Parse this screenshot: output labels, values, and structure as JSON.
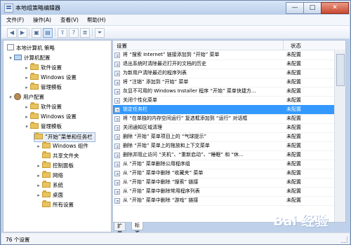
{
  "window": {
    "title": "本地组策略编辑器",
    "controls": {
      "minimize": "—",
      "maximize": "□",
      "close": "✕"
    }
  },
  "menu": [
    "文件(F)",
    "操作(A)",
    "查看(V)",
    "帮助(H)"
  ],
  "toolbar": {
    "icons": [
      "back-arrow-icon",
      "forward-arrow-icon",
      "folder-up-icon",
      "show-hide-tree-icon",
      "export-list-icon",
      "help-icon",
      "properties-icon",
      "filter-icon"
    ]
  },
  "tree": {
    "root": "本地计算机 策略",
    "computer_config": "计算机配置",
    "cc_items": [
      "软件设置",
      "Windows 设置",
      "管理模板"
    ],
    "user_config": "用户配置",
    "uc_items": [
      "软件设置",
      "Windows 设置"
    ],
    "admin_templates": "管理模板",
    "at_items": [
      "“开始”菜单和任务栏",
      "Windows 组件",
      "共享文件夹",
      "控制面板",
      "网络",
      "系统",
      "桌面",
      "所有设置"
    ]
  },
  "list": {
    "col_setting": "设置",
    "col_state": "状态",
    "rows": [
      {
        "name": "将 “搜索 Internet” 链接添加到 “开始” 菜单",
        "state": "未配置"
      },
      {
        "name": "退出系统时清除最近打开的文档的历史",
        "state": "未配置"
      },
      {
        "name": "为新用户清除最近的程序列表",
        "state": "未配置"
      },
      {
        "name": "将 “注销” 添加到 “开始” 菜单",
        "state": "未配置"
      },
      {
        "name": "灰显不可用的 Windows Installer 程序 “开始” 菜单快捷方...",
        "state": "未配置"
      },
      {
        "name": "关闭个性化菜单",
        "state": "未配置"
      },
      {
        "name": "锁定任务栏",
        "state": "未配置"
      },
      {
        "name": "将 “在单独的内存空间运行” 复选框添加到 “运行” 对话框",
        "state": "未配置"
      },
      {
        "name": "关闭通知区域清理",
        "state": "未配置"
      },
      {
        "name": "删除 “开始” 菜单项目上的 “气球提示”",
        "state": "未配置"
      },
      {
        "name": "删除 “开始” 菜单上的拖放和上下文菜单",
        "state": "未配置"
      },
      {
        "name": "删除并阻止访问 “关机”、“重新启动”、“睡眠” 和 “休...",
        "state": "未配置"
      },
      {
        "name": "从 “开始” 菜单删除公用程序组",
        "state": "未配置"
      },
      {
        "name": "从 “开始” 菜单中删除 “收藏夹” 菜单",
        "state": "未配置"
      },
      {
        "name": "从 “开始” 菜单中删除 “搜索” 链接",
        "state": "未配置"
      },
      {
        "name": "从 “开始” 菜单中删除常用程序列表",
        "state": "未配置"
      },
      {
        "name": "从 “开始” 菜单中删除 “游戏” 链接",
        "state": "未配置"
      }
    ]
  },
  "tabs": [
    "扩展",
    "标准"
  ],
  "status": "76 个设置",
  "watermark": "Bai 经验"
}
